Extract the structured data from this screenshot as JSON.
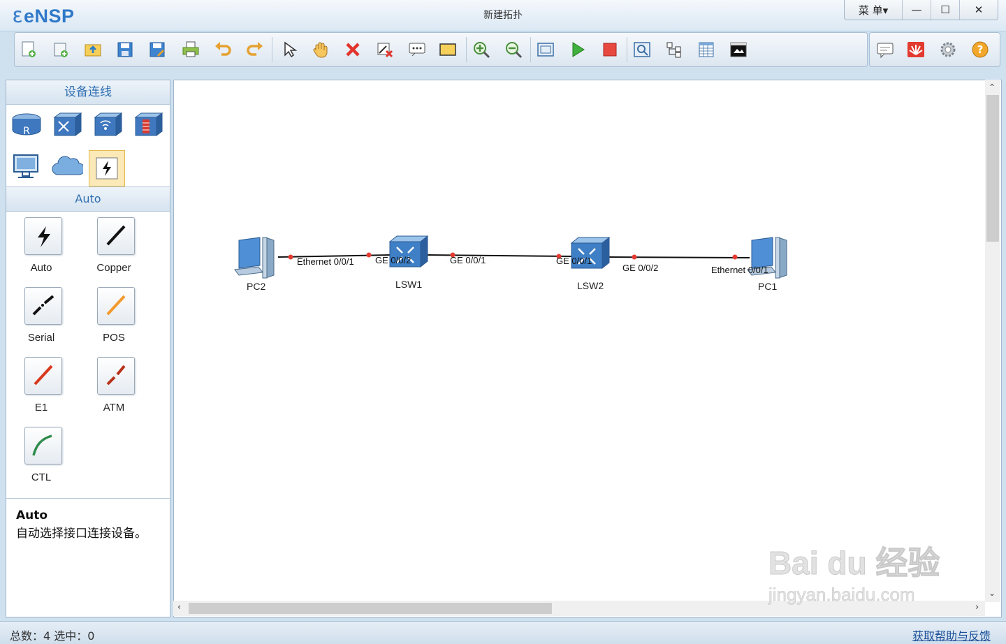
{
  "app": {
    "name": "eNSP",
    "window_title": "新建拓扑"
  },
  "window_controls": {
    "menu": "菜 单▾",
    "minimize": "—",
    "maximize": "☐",
    "close": "✕"
  },
  "toolbar": {
    "buttons": [
      "new-topology",
      "new-page",
      "open",
      "save",
      "save-as",
      "print",
      "undo",
      "redo",
      "select",
      "pan",
      "delete",
      "delete-links",
      "text",
      "rectangle",
      "zoom-in",
      "zoom-out",
      "fit-window",
      "start",
      "stop",
      "capture",
      "topology",
      "grid",
      "terminal"
    ],
    "right_buttons": [
      "chat",
      "huawei",
      "settings",
      "help"
    ]
  },
  "left_panel": {
    "header": "设备连线",
    "category_header": "Auto",
    "cables": [
      {
        "id": "auto",
        "label": "Auto",
        "color": "#111111"
      },
      {
        "id": "copper",
        "label": "Copper",
        "color": "#111111"
      },
      {
        "id": "serial",
        "label": "Serial",
        "color": "#111111"
      },
      {
        "id": "pos",
        "label": "POS",
        "color": "#f29a2e"
      },
      {
        "id": "e1",
        "label": "E1",
        "color": "#d8381c"
      },
      {
        "id": "atm",
        "label": "ATM",
        "color": "#b8321a"
      },
      {
        "id": "ctl",
        "label": "CTL",
        "color": "#2f8c4d"
      }
    ],
    "description": {
      "title": "Auto",
      "text": "自动选择接口连接设备。"
    }
  },
  "topology": {
    "nodes": [
      {
        "id": "pc2",
        "label": "PC2"
      },
      {
        "id": "lsw1",
        "label": "LSW1"
      },
      {
        "id": "lsw2",
        "label": "LSW2"
      },
      {
        "id": "pc1",
        "label": "PC1"
      }
    ],
    "ports": [
      "Ethernet 0/0/1",
      "GE 0/0/2",
      "GE 0/0/1",
      "GE 0/0/1",
      "GE 0/0/2",
      "Ethernet 0/0/1"
    ]
  },
  "status": {
    "left": "总数：4  选中：0",
    "right": "获取帮助与反馈"
  },
  "watermark": {
    "line1": "Bai du 经验",
    "line2": "jingyan.baidu.com"
  }
}
